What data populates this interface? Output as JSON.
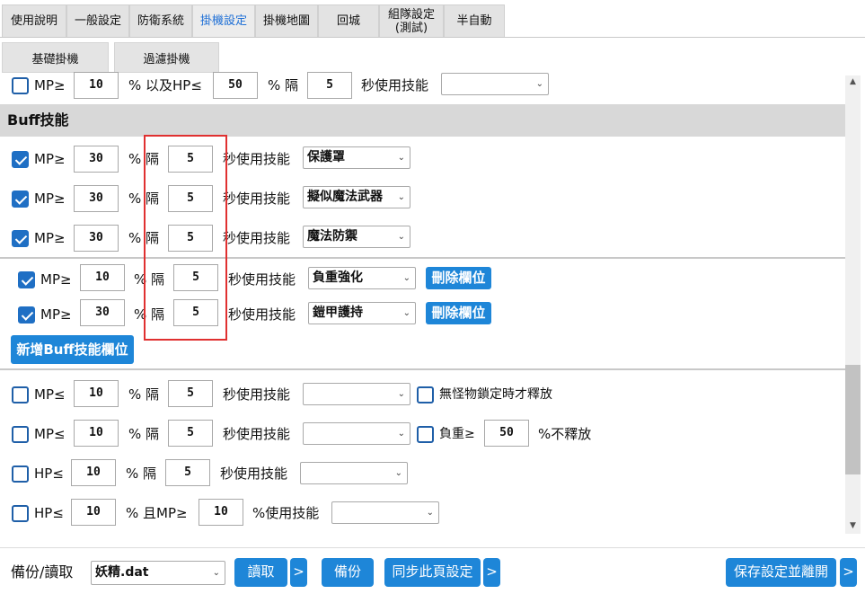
{
  "tabs": [
    "使用說明",
    "一般設定",
    "防衛系統",
    "掛機設定",
    "掛機地圖",
    "回城",
    "組隊設定\n(測試)",
    "半自動"
  ],
  "subtabs": [
    "基礎掛機",
    "過濾掛機"
  ],
  "top_row": {
    "mp_label": "MP≥",
    "mp": "10",
    "hp_label": "% 以及HP≤",
    "hp": "50",
    "sep": "% 隔",
    "sec": "5",
    "skill_label": "秒使用技能",
    "skill": ""
  },
  "buff_title": "Buff技能",
  "common": {
    "mp_ge": "MP≥",
    "pct_sep": "% 隔",
    "skill_label": "秒使用技能",
    "delete": "刪除欄位"
  },
  "buff_rows": [
    {
      "mp": "30",
      "sec": "5",
      "skill": "保護罩"
    },
    {
      "mp": "30",
      "sec": "5",
      "skill": "擬似魔法武器"
    },
    {
      "mp": "30",
      "sec": "5",
      "skill": "魔法防禦"
    }
  ],
  "extra_rows": [
    {
      "mp": "10",
      "sec": "5",
      "skill": "負重強化"
    },
    {
      "mp": "30",
      "sec": "5",
      "skill": "鎧甲護持"
    }
  ],
  "add_buff": "新增Buff技能欄位",
  "lower": {
    "mp_le": "MP≤",
    "hp_le": "HP≤",
    "pct_sep": "% 隔",
    "skill_label": "秒使用技能",
    "r1": {
      "val": "10",
      "sec": "5",
      "extra": "無怪物鎖定時才釋放"
    },
    "r2": {
      "val": "10",
      "sec": "5",
      "weight_label": "負重≥",
      "weight": "50",
      "weight_suffix": "%不釋放"
    },
    "r3": {
      "val": "10",
      "sec": "5"
    },
    "r4": {
      "val": "10",
      "and_label": "% 且MP≥",
      "mp": "10",
      "pct_skill": "%使用技能"
    }
  },
  "footer": {
    "backup_label": "備份/讀取",
    "file": "妖精.dat",
    "read": "讀取",
    "arrow": ">",
    "backup": "備份",
    "sync": "同步此頁設定",
    "save": "保存設定並離開"
  },
  "icons": {
    "dropdown": "chevron-down-icon",
    "check": "check-icon"
  },
  "colors": {
    "accent": "#1e86d8",
    "highlight": "#e03030",
    "active_tab": "#1e6fd6"
  }
}
